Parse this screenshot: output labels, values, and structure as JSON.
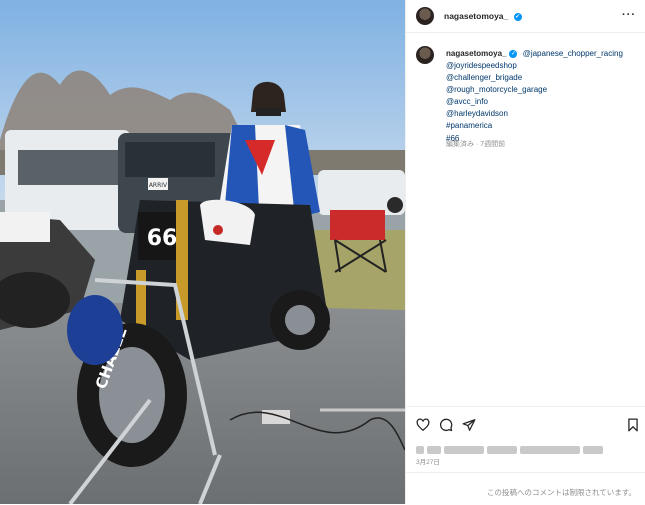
{
  "post": {
    "author": "nagasetomoya_",
    "caption_tags": [
      "@japanese_chopper_racing",
      "@joyridespeedshop",
      "@challenger_brigade",
      "@rough_motorcycle_garage",
      "@avcc_info",
      "@harleydavidson",
      "#panamerica",
      "#66"
    ],
    "meta": "編集済み · 7週間前",
    "date": "3月27日"
  },
  "photo": {
    "bike_number": "66",
    "tire_text": "CHALLE",
    "sign_text": "ARRIV"
  },
  "footer": {
    "comments_disabled": "この投稿へのコメントは制限されています。"
  },
  "icons": [
    "heart-icon",
    "comment-icon",
    "share-icon",
    "bookmark-icon",
    "more-options-icon",
    "verified-icon"
  ],
  "colors": {
    "link": "#00376b",
    "verified": "#0095f6",
    "meta": "#8e8e8e"
  }
}
